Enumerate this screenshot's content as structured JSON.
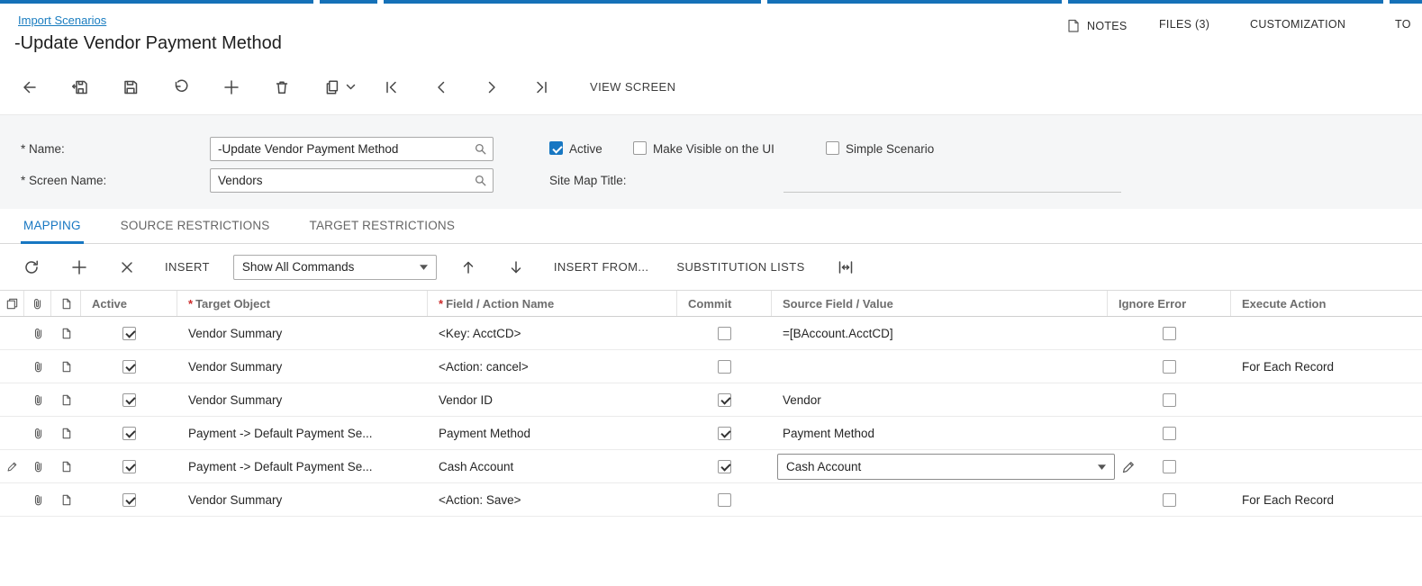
{
  "page": {
    "breadcrumb": "Import Scenarios",
    "title": "-Update Vendor Payment Method"
  },
  "header_right": {
    "notes_label": "NOTES",
    "files_label": "FILES (3)",
    "customization_label": "CUSTOMIZATION",
    "tools_label": "TO"
  },
  "main_toolbar": {
    "view_screen_label": "VIEW SCREEN"
  },
  "form": {
    "name_label": "* Name:",
    "name_value": "-Update Vendor Payment Method",
    "screen_name_label": "* Screen Name:",
    "screen_name_value": "Vendors",
    "active_label": "Active",
    "active_checked": true,
    "make_visible_label": "Make Visible on the UI",
    "make_visible_checked": false,
    "simple_scenario_label": "Simple Scenario",
    "simple_scenario_checked": false,
    "site_map_title_label": "Site Map Title:",
    "site_map_title_value": ""
  },
  "tabs": {
    "mapping": "MAPPING",
    "source_restrictions": "SOURCE RESTRICTIONS",
    "target_restrictions": "TARGET RESTRICTIONS"
  },
  "grid_toolbar": {
    "insert_label": "INSERT",
    "commands_dropdown_value": "Show All Commands",
    "insert_from_label": "INSERT FROM...",
    "substitution_lists_label": "SUBSTITUTION LISTS"
  },
  "grid": {
    "required_mark": "*",
    "columns": {
      "active": "Active",
      "target_object": "Target Object",
      "field_action_name": "Field / Action Name",
      "commit": "Commit",
      "source_field_value": "Source Field / Value",
      "ignore_error": "Ignore Error",
      "execute_action": "Execute Action"
    },
    "rows": [
      {
        "active": true,
        "target_object": "Vendor Summary",
        "field_action_name": "<Key: AcctCD>",
        "commit": false,
        "source_field_value": "=[BAccount.AcctCD]",
        "ignore_error": false,
        "execute_action": ""
      },
      {
        "active": true,
        "target_object": "Vendor Summary",
        "field_action_name": "<Action: cancel>",
        "commit": false,
        "source_field_value": "",
        "ignore_error": false,
        "execute_action": "For Each Record"
      },
      {
        "active": true,
        "target_object": "Vendor Summary",
        "field_action_name": "Vendor ID",
        "commit": true,
        "source_field_value": "Vendor",
        "ignore_error": false,
        "execute_action": ""
      },
      {
        "active": true,
        "target_object": "Payment -> Default Payment Se...",
        "field_action_name": "Payment Method",
        "commit": true,
        "source_field_value": "Payment Method",
        "ignore_error": false,
        "execute_action": ""
      },
      {
        "active": true,
        "target_object": "Payment -> Default Payment Se...",
        "field_action_name": "Cash Account",
        "commit": true,
        "source_field_value": "Cash Account",
        "ignore_error": false,
        "execute_action": "",
        "editing": true
      },
      {
        "active": true,
        "target_object": "Vendor Summary",
        "field_action_name": "<Action: Save>",
        "commit": false,
        "source_field_value": "",
        "ignore_error": false,
        "execute_action": "For Each Record"
      }
    ]
  },
  "colors": {
    "accent_blue": "#1777c2",
    "link_blue": "#1a7dc0",
    "required_red": "#cc2a2a"
  }
}
